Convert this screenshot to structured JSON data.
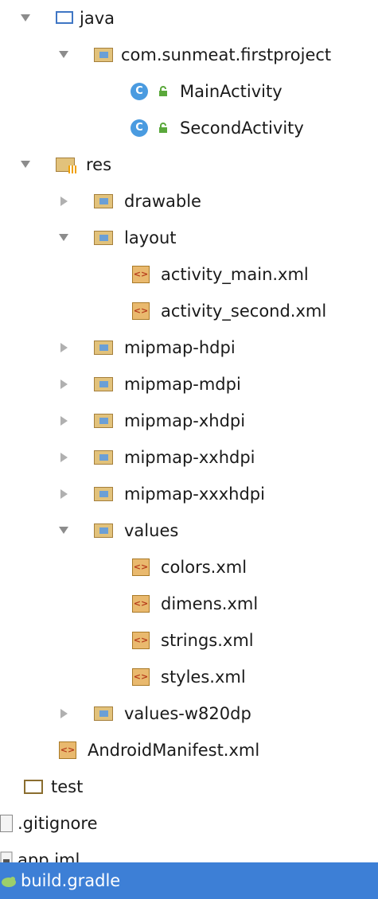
{
  "tree": {
    "java": "java",
    "package": "com.sunmeat.firstproject",
    "main_activity": "MainActivity",
    "second_activity": "SecondActivity",
    "res": "res",
    "drawable": "drawable",
    "layout": "layout",
    "activity_main": "activity_main.xml",
    "activity_second": "activity_second.xml",
    "mipmap_hdpi": "mipmap-hdpi",
    "mipmap_mdpi": "mipmap-mdpi",
    "mipmap_xhdpi": "mipmap-xhdpi",
    "mipmap_xxhdpi": "mipmap-xxhdpi",
    "mipmap_xxxhdpi": "mipmap-xxxhdpi",
    "values": "values",
    "colors": "colors.xml",
    "dimens": "dimens.xml",
    "strings": "strings.xml",
    "styles": "styles.xml",
    "values_w820dp": "values-w820dp",
    "manifest": "AndroidManifest.xml",
    "test": "test",
    "gitignore": ".gitignore",
    "app_iml": "app.iml",
    "build_gradle": "build.gradle"
  },
  "icons": {
    "class_letter": "C",
    "xml_glyph": "<>"
  },
  "colors": {
    "selection": "#3d7fd6",
    "folder_blue": "#3f76c4",
    "class_badge": "#4a9be0"
  }
}
